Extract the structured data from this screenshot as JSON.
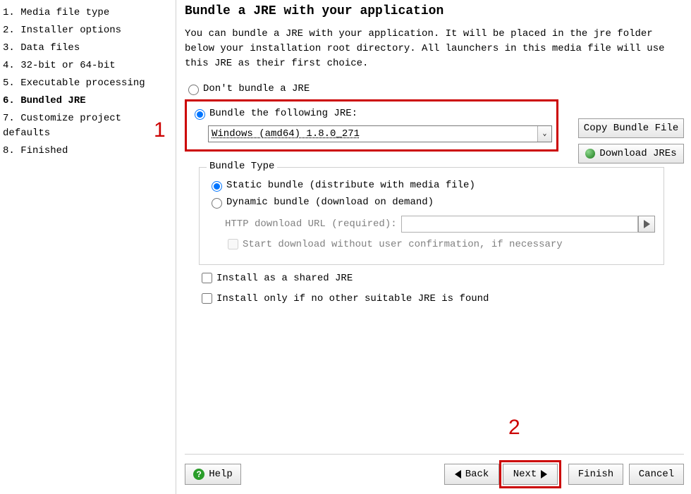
{
  "sidebar": {
    "steps": [
      {
        "n": "1.",
        "label": "Media file type"
      },
      {
        "n": "2.",
        "label": "Installer options"
      },
      {
        "n": "3.",
        "label": "Data files"
      },
      {
        "n": "4.",
        "label": "32-bit or 64-bit"
      },
      {
        "n": "5.",
        "label": "Executable processing"
      },
      {
        "n": "6.",
        "label": "Bundled JRE"
      },
      {
        "n": "7.",
        "label": "Customize project defaults"
      },
      {
        "n": "8.",
        "label": "Finished"
      }
    ],
    "active_index": 5
  },
  "page": {
    "title": "Bundle a JRE with your application",
    "description": "You can bundle a JRE with your application. It will be placed in the jre folder below your installation root directory. All launchers in this media file will use this JRE as their first choice.",
    "opt_no_bundle": "Don't bundle a JRE",
    "opt_bundle": "Bundle the following JRE:",
    "jre_value": "Windows (amd64) 1.8.0_271",
    "copy_btn": "Copy Bundle File",
    "download_btn": "Download JREs",
    "bundle_type_legend": "Bundle Type",
    "opt_static": "Static bundle (distribute with media file)",
    "opt_dynamic": "Dynamic bundle (download on demand)",
    "url_label": "HTTP download URL (required):",
    "cb_start_download": "Start download without user confirmation, if necessary",
    "cb_shared": "Install as a shared JRE",
    "cb_only_if": "Install only if no other suitable JRE is found"
  },
  "footer": {
    "help": "Help",
    "back": "Back",
    "next": "Next",
    "finish": "Finish",
    "cancel": "Cancel"
  },
  "annotations": {
    "a1": "1",
    "a2": "2"
  }
}
